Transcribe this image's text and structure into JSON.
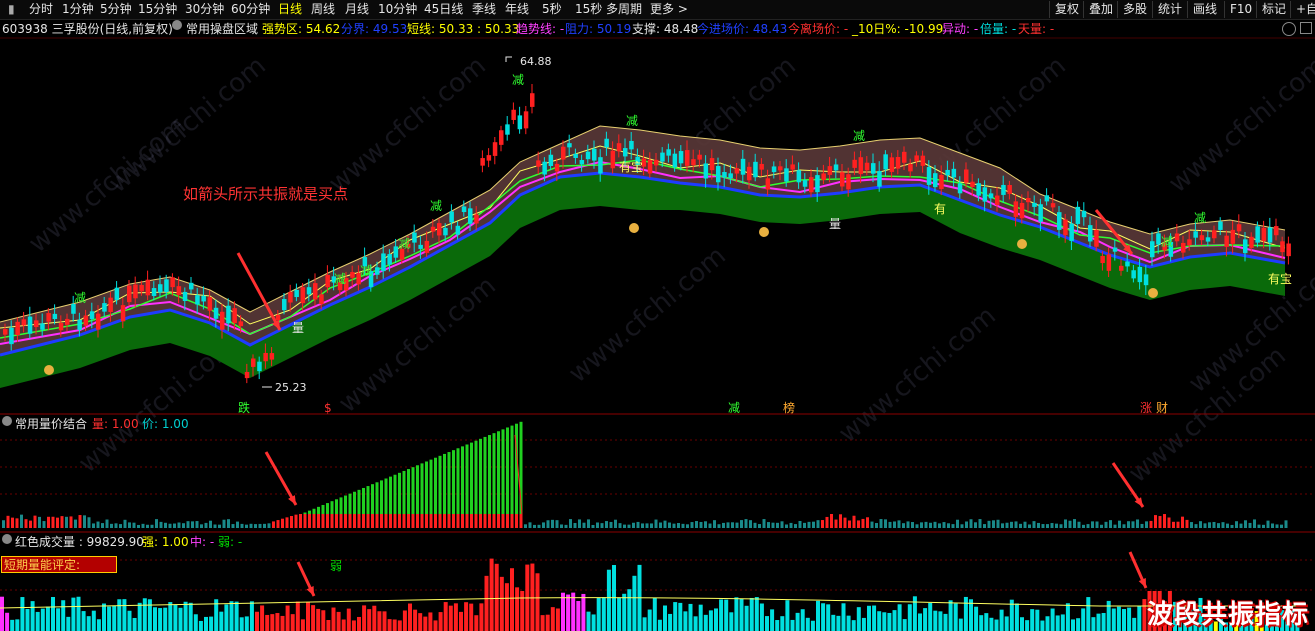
{
  "toolbar": {
    "periods": [
      "分时",
      "1分钟",
      "5分钟",
      "15分钟",
      "30分钟",
      "60分钟",
      "日线",
      "周线",
      "月线",
      "10分钟",
      "45日线",
      "季线",
      "年线",
      "5秒",
      "15秒",
      "多周期",
      "更多 >"
    ],
    "active_period": "日线",
    "right_buttons": [
      "复权",
      "叠加",
      "多股",
      "统计",
      "画线",
      "F10",
      "标记",
      "+自"
    ]
  },
  "info": {
    "stock": "603938 三孚股份(日线,前复权)",
    "indicator": "常用操盘区域",
    "qsq": "强势区: 54.62",
    "fj": "分界: 49.53",
    "dx": "短线: 50.33 : 50.33",
    "qsx": "趋势线: -",
    "zl": "阻力: 50.19",
    "zc": "支撑: 48.48",
    "jjc": "今进场价: 48.43",
    "jlc": "今离场价: -",
    "ten": "_10日%: -10.99",
    "yd": "异动: -",
    "bl": "倍量: -",
    "tl": "天量: -"
  },
  "panel2": {
    "name": "常用量价结合",
    "liang": "量: 1.00",
    "jia": "价: 1.00"
  },
  "panel3": {
    "name": "红色成交量 : 99829.90",
    "qiang": "强: 1.00",
    "zhong": "中: -",
    "ruo": "弱: -",
    "energy_label": "短期量能评定:",
    "ruo_mark": "弱"
  },
  "annotation": "如箭头所示共振就是买点",
  "brand": "波段共振指标",
  "watermark": "www.cfchi.com",
  "price_labels": {
    "high": "64.88",
    "low": "25.23"
  },
  "markers": {
    "jian": "减",
    "you": "有",
    "youbao": "有宝",
    "liang": "量",
    "bottom_row": [
      "跌",
      "$",
      "减",
      "榜",
      "涨",
      "财"
    ]
  },
  "colors": {
    "up": "#ff2020",
    "down": "#00e0e0",
    "band_green": "#0a6a0a",
    "band_brown": "#5a3838",
    "blue_line": "#1e3cff",
    "magenta": "#ff30ff",
    "yellow": "#ffff60"
  }
}
